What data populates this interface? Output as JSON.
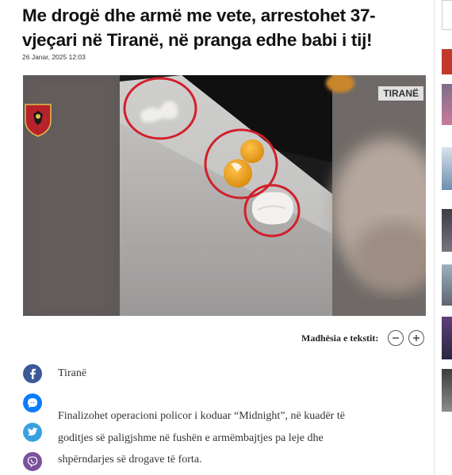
{
  "article": {
    "title": "Me drogë dhe armë me vete, arrestohet 37-vjeçari në Tiranë, në pranga edhe babi i tij!",
    "date": "26 Janar, 2025 12:03",
    "photo_tag": "TIRANË",
    "place": "Tiranë",
    "lead": "Finalizohet operacioni policor i koduar “Midnight”, në kuadër të goditjes së paligjshme në fushën e armëmbajtjes pa leje dhe shpërndarjes së drogave të forta."
  },
  "text_size": {
    "label": "Madhësia e tekstit:",
    "decrease_icon": "minus-icon",
    "increase_icon": "plus-icon"
  },
  "share": [
    {
      "name": "facebook",
      "icon": "facebook-icon",
      "color": "#3b5998"
    },
    {
      "name": "messenger",
      "icon": "messenger-icon",
      "color": "#0a7cff"
    },
    {
      "name": "twitter",
      "icon": "twitter-icon",
      "color": "#39a0e0"
    },
    {
      "name": "viber",
      "icon": "viber-icon",
      "color": "#7b519d"
    }
  ],
  "colors": {
    "annotation_circle": "#d21f2a",
    "police_logo": "#b8222a"
  }
}
